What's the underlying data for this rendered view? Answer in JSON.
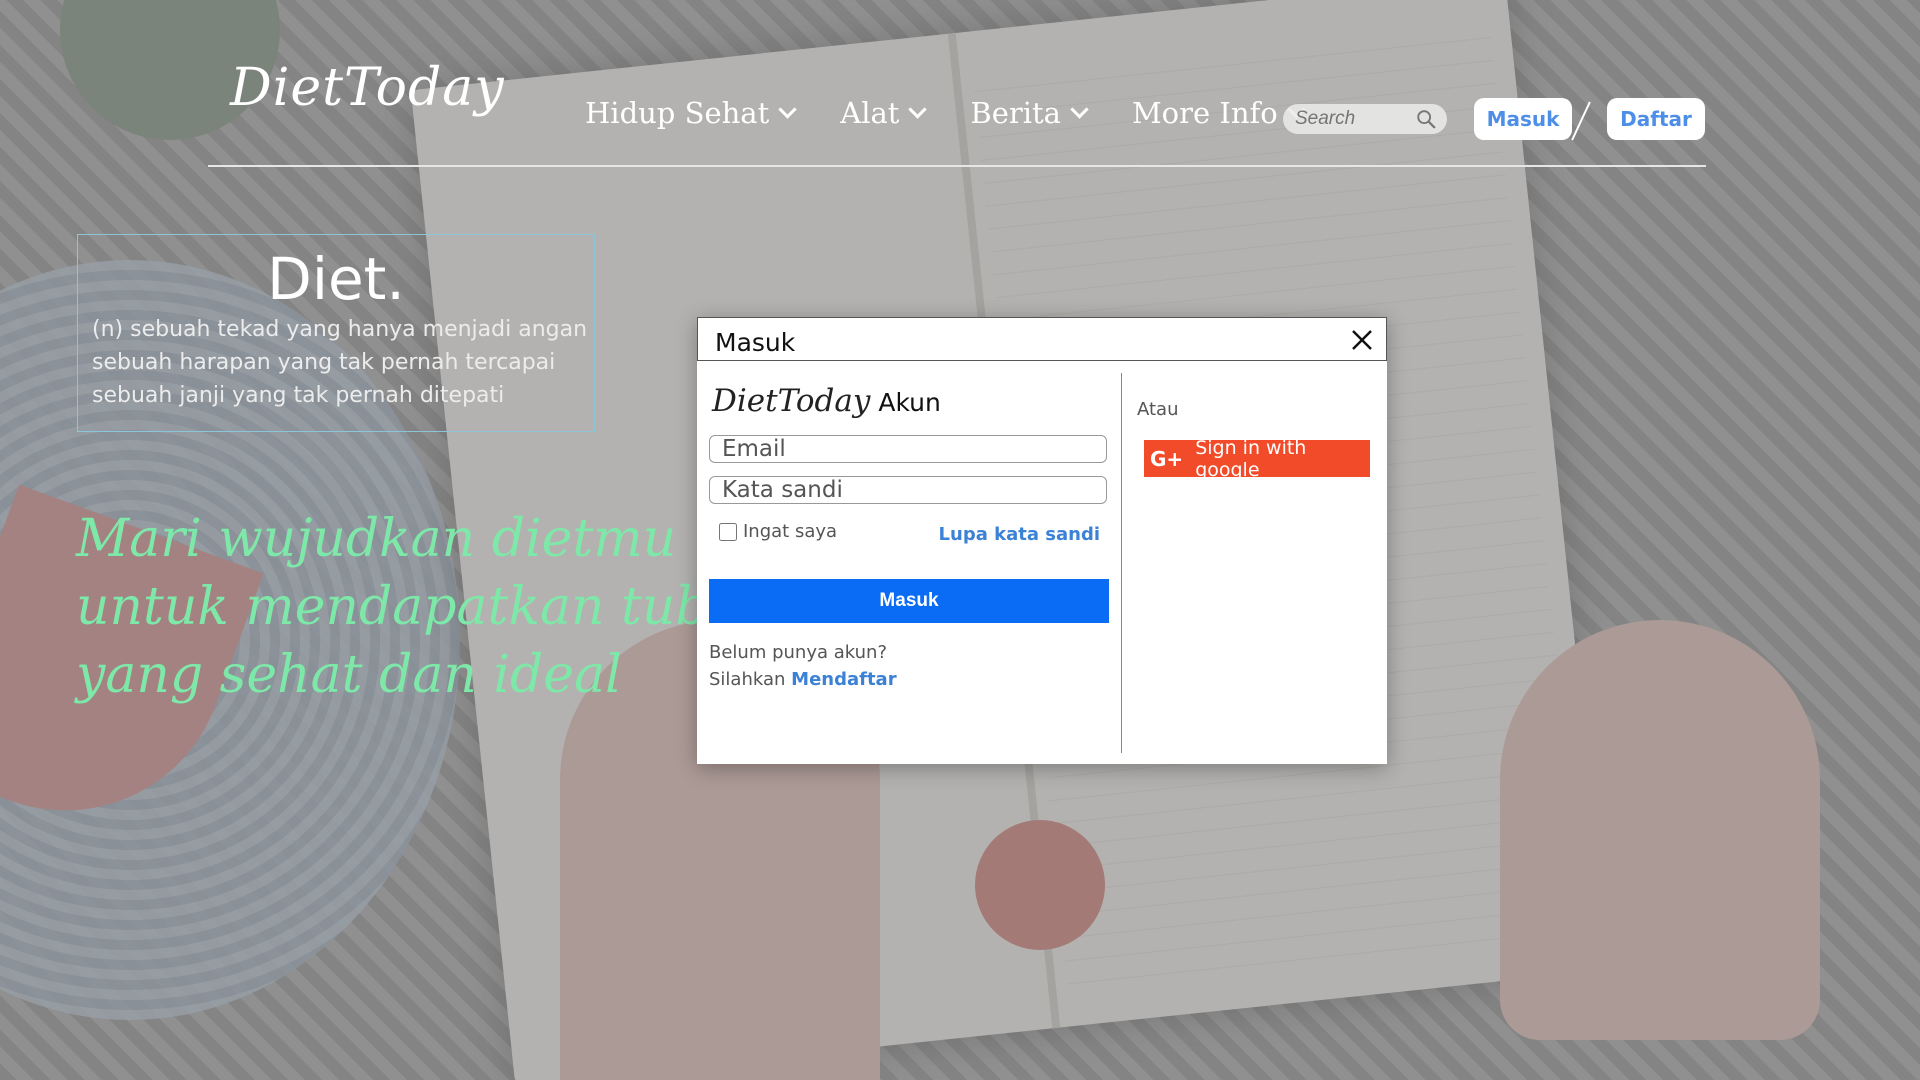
{
  "header": {
    "logo": "DietToday",
    "nav": [
      {
        "label": "Hidup Sehat"
      },
      {
        "label": "Alat"
      },
      {
        "label": "Berita"
      },
      {
        "label": "More Info"
      }
    ],
    "search": {
      "placeholder": "Search"
    },
    "login_label": "Masuk",
    "register_label": "Daftar"
  },
  "hero": {
    "definition_title": "Diet.",
    "definition_lines": [
      "(n) sebuah tekad yang hanya menjadi angan",
      "sebuah harapan yang tak pernah tercapai",
      "sebuah janji yang tak pernah ditepati"
    ],
    "tagline_lines": [
      "Mari wujudkan dietmu",
      "untuk mendapatkan tubuh",
      "yang sehat dan ideal"
    ]
  },
  "modal": {
    "title": "Masuk",
    "brand_logo": "DietToday",
    "brand_suffix": "Akun",
    "email_placeholder": "Email",
    "password_placeholder": "Kata sandi",
    "remember_label": "Ingat saya",
    "remember_checked": false,
    "forgot_label": "Lupa kata sandi",
    "submit_label": "Masuk",
    "no_account_text": "Belum punya akun?",
    "signup_prefix": "Silahkan",
    "signup_link": "Mendaftar",
    "or_label": "Atau",
    "google_label": "Sign in with google",
    "google_icon": "G+"
  },
  "colors": {
    "accent_blue": "#0a6cf5",
    "link_blue": "#3b82d6",
    "google_red": "#f14b2a",
    "tagline_green": "#7ee8a8"
  }
}
